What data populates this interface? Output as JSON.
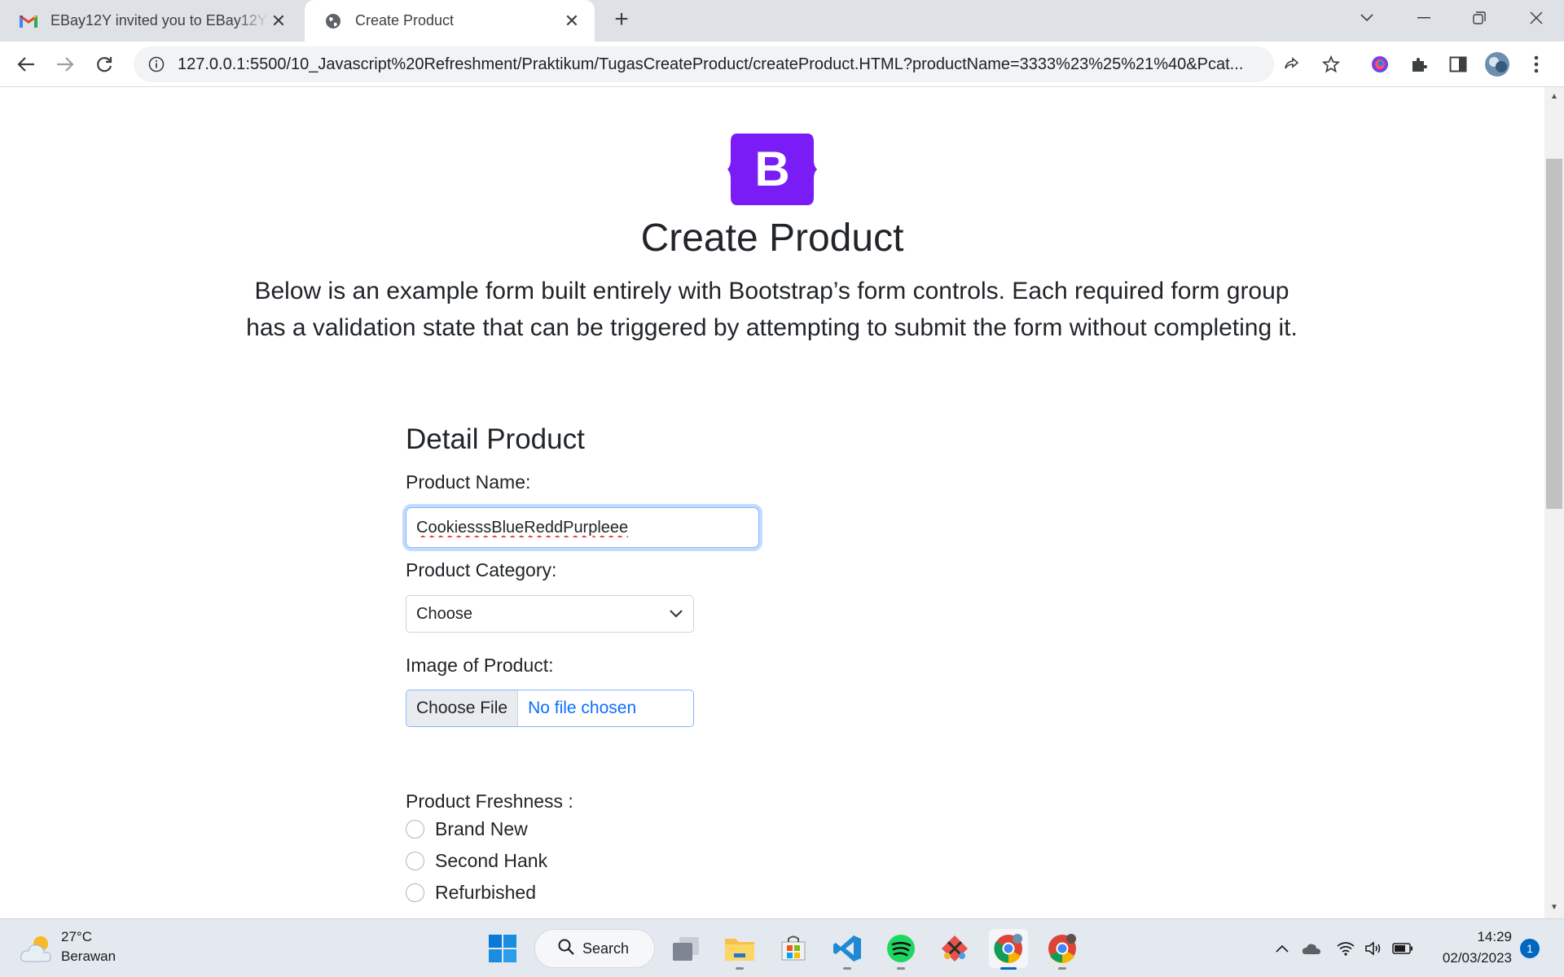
{
  "browser": {
    "tabs": [
      {
        "title": "EBay12Y invited you to EBay12Y/",
        "favicon": "gmail-icon",
        "active": false
      },
      {
        "title": "Create Product",
        "favicon": "globe-icon",
        "active": true
      }
    ],
    "url": "127.0.0.1:5500/10_Javascript%20Refreshment/Praktikum/TugasCreateProduct/createProduct.HTML?productName=3333%23%25%21%40&Pcat..."
  },
  "page": {
    "title": "Create Product",
    "lead": "Below is an example form built entirely with Bootstrap’s form controls. Each required form group has a validation state that can be triggered by attempting to submit the form without completing it.",
    "section_heading": "Detail Product",
    "product_name_label": "Product Name:",
    "product_name_value": "CookiesssBlueReddPurpleee",
    "category_label": "Product Category:",
    "category_value": "Choose",
    "image_label": "Image of Product:",
    "file_button": "Choose File",
    "file_status": "No file chosen",
    "freshness_label": "Product Freshness :",
    "freshness_options": [
      "Brand New",
      "Second Hank",
      "Refurbished"
    ],
    "logo_letter": "B",
    "logo_color": "#7a1cf6"
  },
  "taskbar": {
    "weather_temp": "27°C",
    "weather_desc": "Berawan",
    "search_label": "Search",
    "time": "14:29",
    "date": "02/03/2023",
    "notification_count": "1"
  }
}
